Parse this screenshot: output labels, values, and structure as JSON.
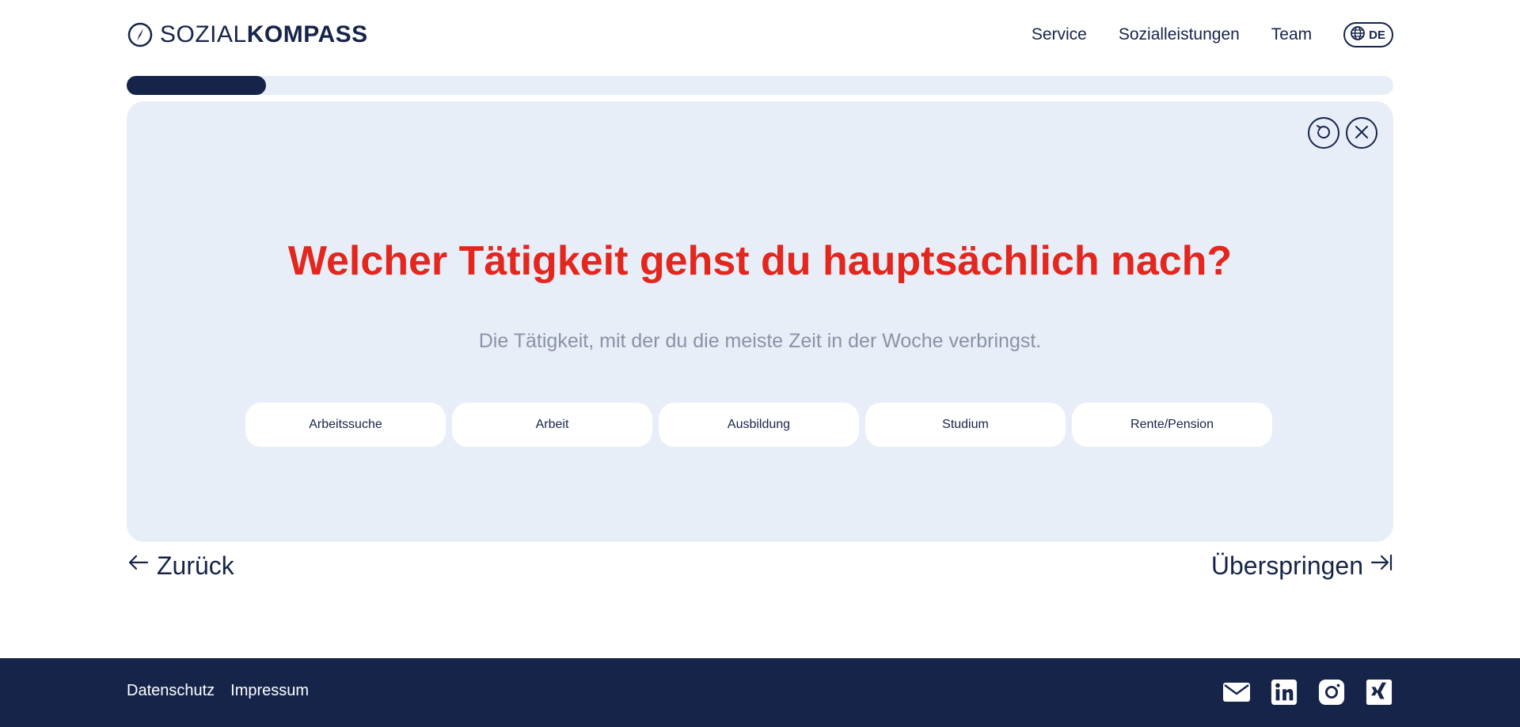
{
  "brand": {
    "light": "SOZIAL",
    "bold": "KOMPASS"
  },
  "nav": {
    "items": [
      "Service",
      "Sozialleistungen",
      "Team"
    ],
    "language": "DE"
  },
  "progress": {
    "fraction": 0.11
  },
  "question": {
    "title": "Welcher Tätigkeit gehst du hauptsächlich nach?",
    "subtitle": "Die Tätigkeit, mit der du die meiste Zeit in der Woche verbringst.",
    "options": [
      "Arbeitssuche",
      "Arbeit",
      "Ausbildung",
      "Studium",
      "Rente/Pension"
    ]
  },
  "navigation": {
    "back": "Zurück",
    "skip": "Überspringen"
  },
  "footer": {
    "links": [
      "Datenschutz",
      "Impressum"
    ],
    "social": [
      "mail-icon",
      "linkedin-icon",
      "instagram-icon",
      "xing-icon"
    ]
  },
  "colors": {
    "navy": "#16244a",
    "accent_red": "#e3261e",
    "card_bg": "#e8eef8",
    "muted": "#8a93a6"
  }
}
